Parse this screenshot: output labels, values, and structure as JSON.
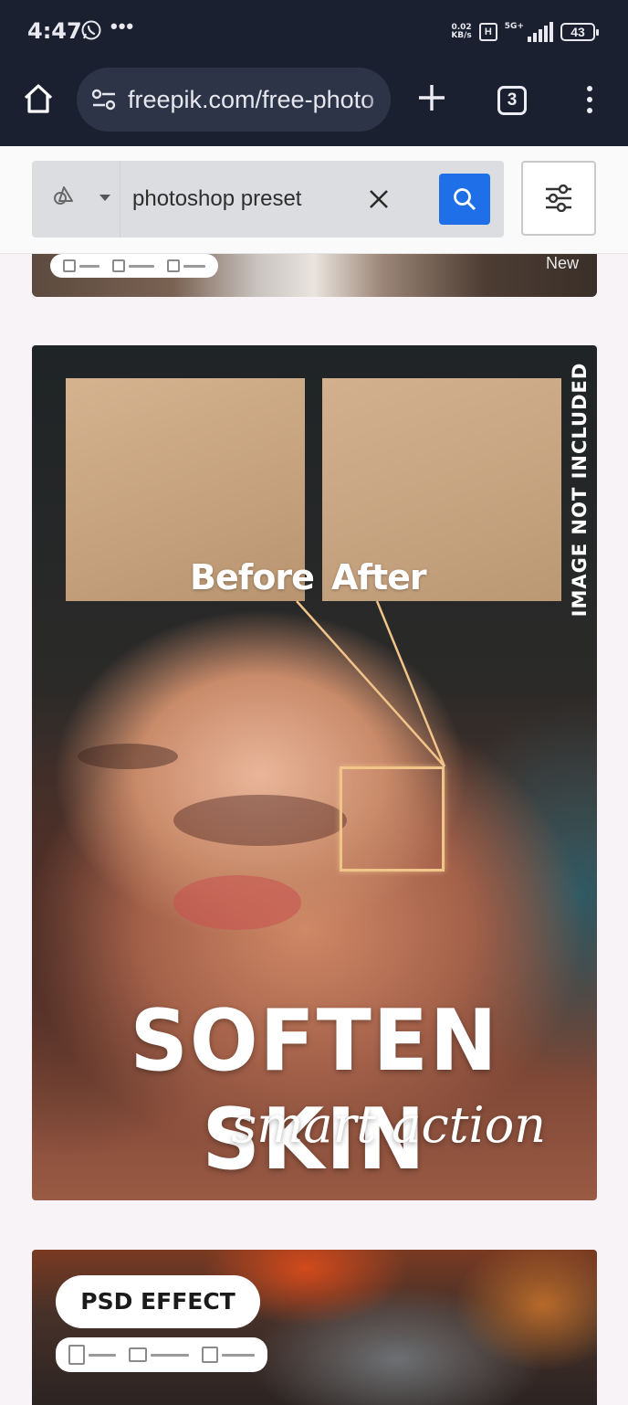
{
  "status_bar": {
    "time": "4:47",
    "net_speed_value": "0.02",
    "net_speed_unit": "KB/s",
    "signal_label": "5G+",
    "battery": "43"
  },
  "browser": {
    "url": "freepik.com/free-photo",
    "tab_count": "3"
  },
  "search": {
    "query": "photoshop preset"
  },
  "results": [
    {
      "badge": "New"
    },
    {
      "overlay_before": "Before",
      "overlay_after": "After",
      "vertical_note": "IMAGE NOT INCLUDED",
      "title": "SOFTEN SKIN",
      "subtitle": "smart action"
    },
    {
      "tag": "PSD EFFECT"
    }
  ],
  "colors": {
    "chrome_bg": "#1b2030",
    "search_button": "#1e6fe8",
    "zoom_outline": "#f1c48a"
  },
  "icons": [
    "whatsapp-icon",
    "home-icon",
    "site-settings-icon",
    "plus-icon",
    "tab-switcher-icon",
    "kebab-menu-icon",
    "asset-type-icon",
    "chevron-down-icon",
    "close-icon",
    "search-icon",
    "filter-icon"
  ]
}
